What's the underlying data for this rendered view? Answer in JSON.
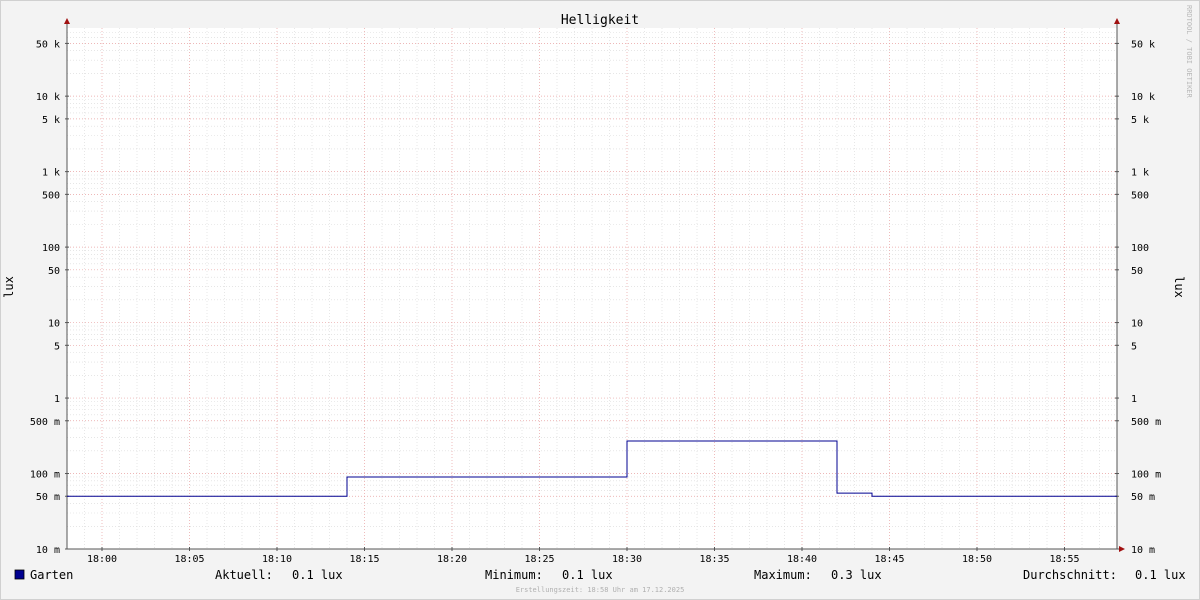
{
  "chart_data": {
    "type": "line",
    "title": "Helligkeit",
    "ylabel": "lux",
    "yscale": "log",
    "ylim": [
      0.01,
      80000
    ],
    "xlim": [
      "17:58",
      "18:58"
    ],
    "y_ticks": [
      {
        "value": 0.01,
        "label": "10 m"
      },
      {
        "value": 0.05,
        "label": "50 m"
      },
      {
        "value": 0.1,
        "label": "100 m"
      },
      {
        "value": 0.5,
        "label": "500 m"
      },
      {
        "value": 1,
        "label": "1"
      },
      {
        "value": 5,
        "label": "5"
      },
      {
        "value": 10,
        "label": "10"
      },
      {
        "value": 50,
        "label": "50"
      },
      {
        "value": 100,
        "label": "100"
      },
      {
        "value": 500,
        "label": "500"
      },
      {
        "value": 1000,
        "label": "1 k"
      },
      {
        "value": 5000,
        "label": "5 k"
      },
      {
        "value": 10000,
        "label": "10 k"
      },
      {
        "value": 50000,
        "label": "50 k"
      }
    ],
    "x_ticks": [
      "18:00",
      "18:05",
      "18:10",
      "18:15",
      "18:20",
      "18:25",
      "18:30",
      "18:35",
      "18:40",
      "18:45",
      "18:50",
      "18:55"
    ],
    "grid": true,
    "series": [
      {
        "name": "Garten",
        "color": "#000090",
        "step": true,
        "points": [
          {
            "t": "17:58",
            "v": 0.05
          },
          {
            "t": "18:14",
            "v": 0.09
          },
          {
            "t": "18:30",
            "v": 0.27
          },
          {
            "t": "18:42",
            "v": 0.055
          },
          {
            "t": "18:44",
            "v": 0.05
          },
          {
            "t": "18:58",
            "v": 0.05
          }
        ]
      }
    ]
  },
  "legend": {
    "series_name": "Garten",
    "swatch_color": "#000090",
    "stats": [
      {
        "label": "Aktuell:",
        "value": "0.1 lux"
      },
      {
        "label": "Minimum:",
        "value": "0.1 lux"
      },
      {
        "label": "Maximum:",
        "value": "0.3 lux"
      },
      {
        "label": "Durchschnitt:",
        "value": "0.1 lux"
      }
    ]
  },
  "side_watermark": "RRDTOOL / TOBI OETIKER",
  "footer": "Erstellungszeit: 18:58 Uhr am 17.12.2025",
  "colors": {
    "background": "#f3f3f3",
    "canvas": "#ffffff",
    "major_grid": "#e8a0a0",
    "minor_grid": "#d8d8d8",
    "axis": "#555555",
    "arrow": "#a01010"
  }
}
